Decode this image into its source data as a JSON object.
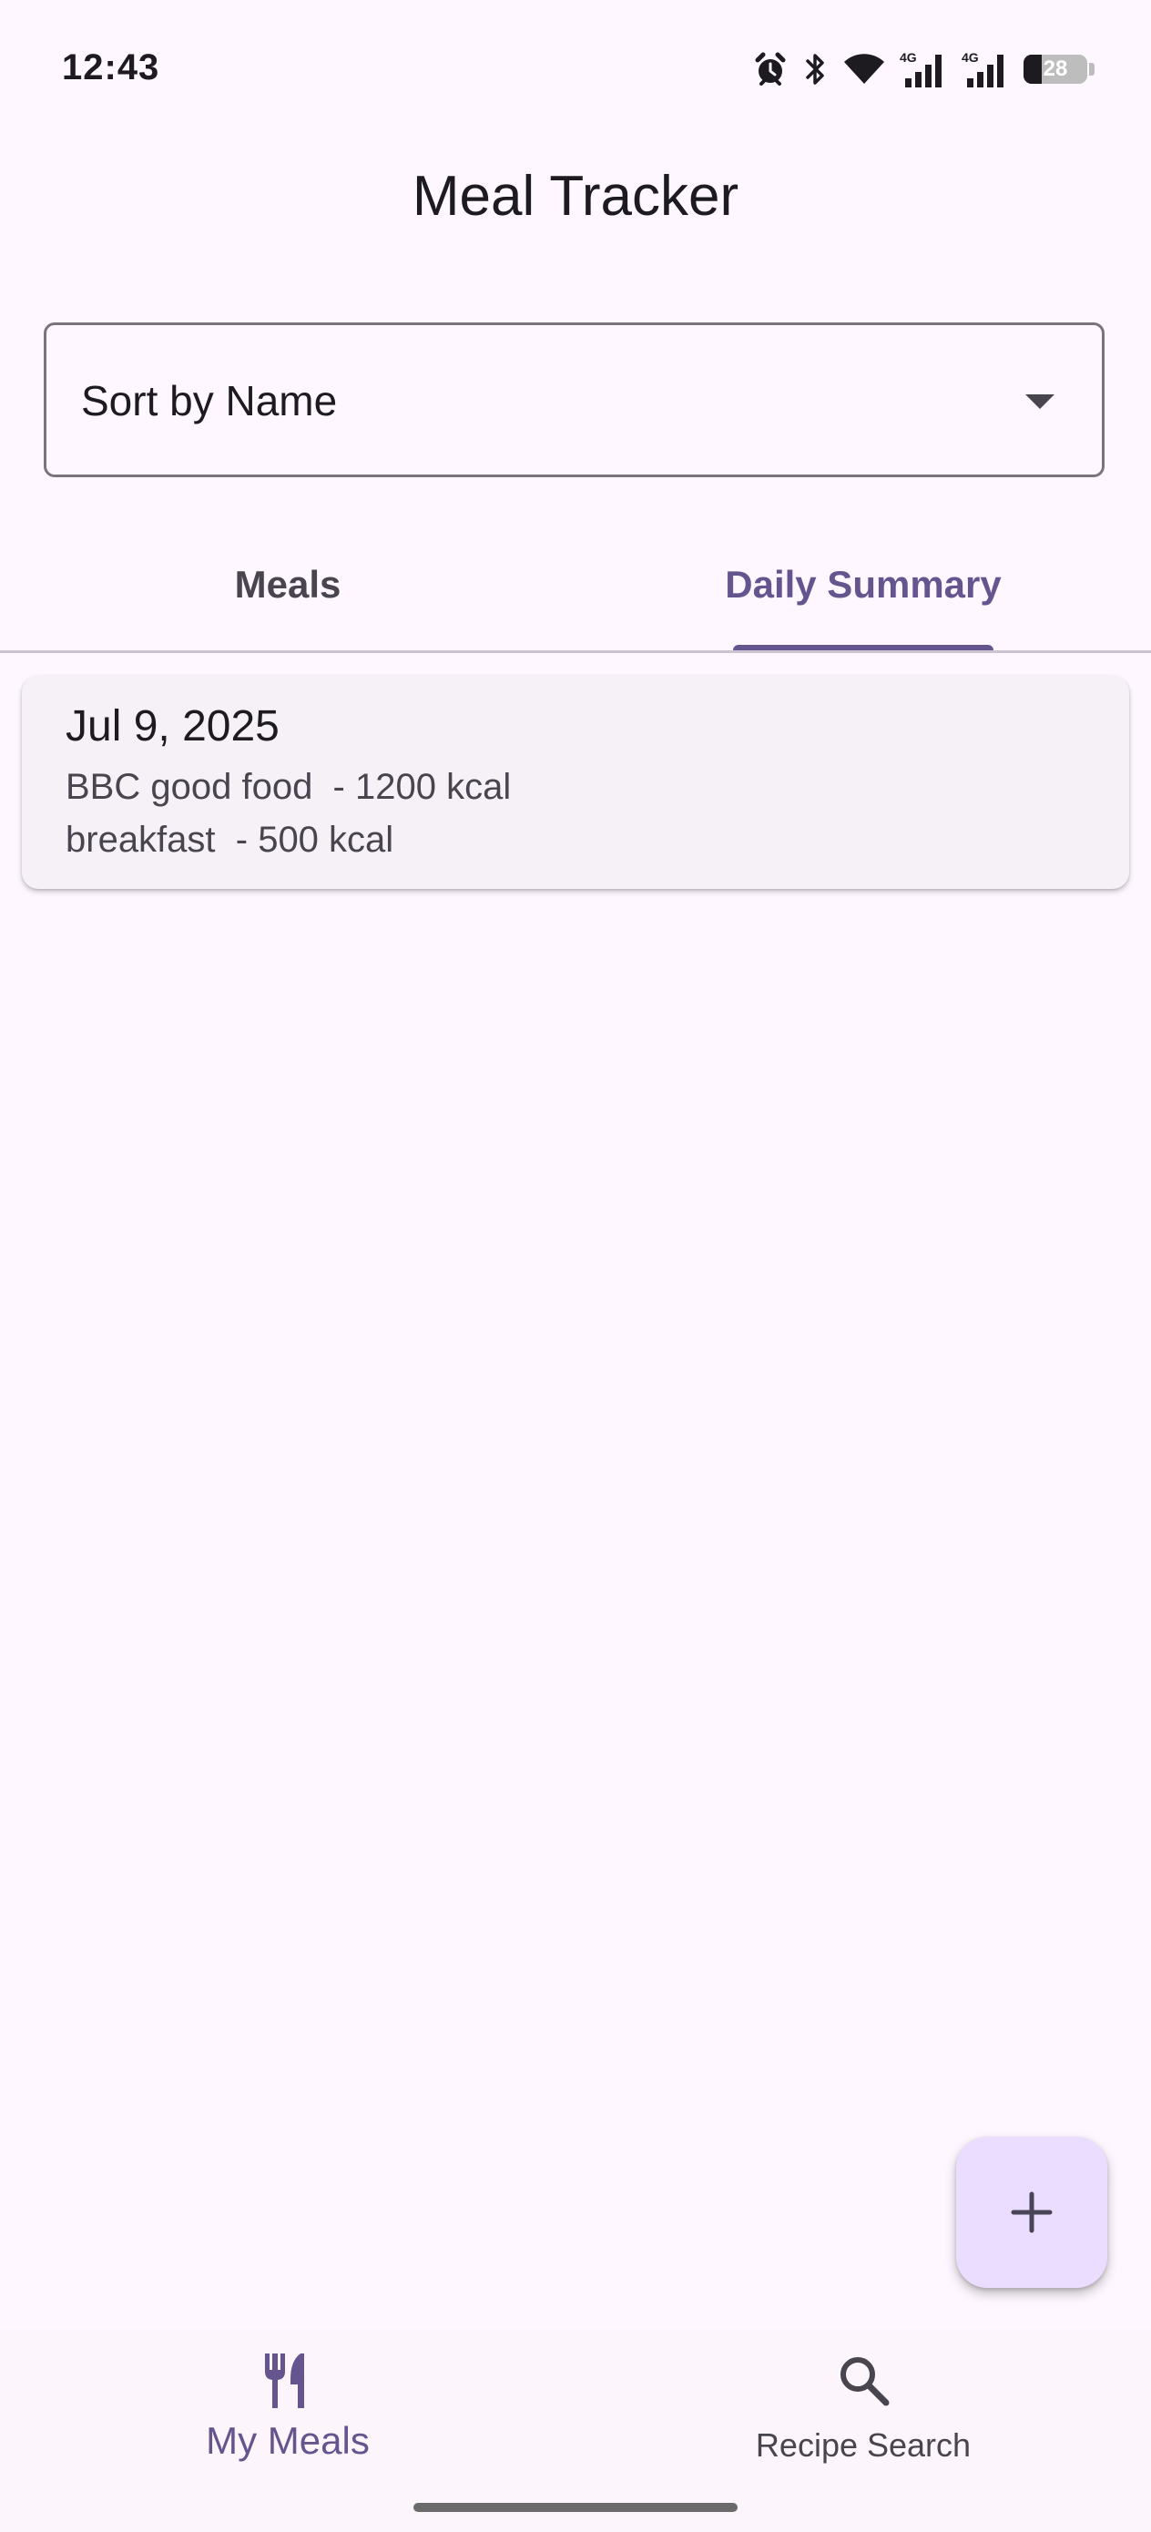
{
  "status_bar": {
    "time": "12:43",
    "icons": [
      "alarm-icon",
      "bluetooth-icon",
      "wifi-icon",
      "signal-4g-icon",
      "signal-4g-icon"
    ],
    "signal_label": "4G",
    "battery_level": "28",
    "battery_percent": 28
  },
  "app_bar": {
    "title": "Meal Tracker"
  },
  "sort": {
    "selected": "Sort by Name",
    "icon": "dropdown-arrow-icon"
  },
  "tabs": [
    {
      "label": "Meals",
      "selected": false
    },
    {
      "label": "Daily Summary",
      "selected": true
    }
  ],
  "summary": [
    {
      "date": "Jul 9, 2025",
      "entries": [
        {
          "text": "BBC good food  - 1200 kcal"
        },
        {
          "text": "breakfast  - 500 kcal"
        }
      ]
    }
  ],
  "fab": {
    "icon": "add-icon"
  },
  "bottom_nav": [
    {
      "label": "My Meals",
      "icon": "restaurant-icon",
      "selected": true
    },
    {
      "label": "Recipe Search",
      "icon": "search-icon",
      "selected": false
    }
  ],
  "colors": {
    "background": "#FEF7FF",
    "accent": "#65558F",
    "fab_container": "#EADDFF",
    "card": "#F5F1F7",
    "outline": "#79747E"
  }
}
